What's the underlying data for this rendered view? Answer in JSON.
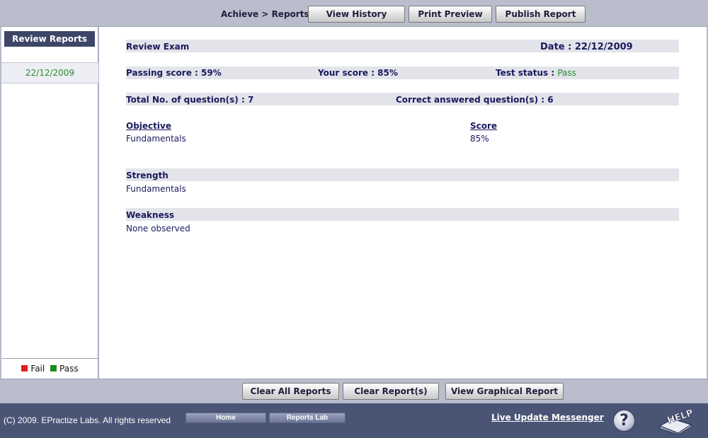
{
  "header": {
    "breadcrumb": "Achieve > Reports",
    "buttons": {
      "view_history": "View History",
      "print_preview": "Print Preview",
      "publish_report": "Publish Report"
    }
  },
  "sidebar": {
    "title": "Review Reports",
    "dates": [
      "22/12/2009"
    ],
    "legend": {
      "fail": "Fail",
      "pass": "Pass"
    }
  },
  "report": {
    "exam_name": "Review Exam",
    "date_label": "Date : 22/12/2009",
    "passing_score": "Passing score : 59%",
    "your_score": "Your score : 85%",
    "test_status_label": "Test status : ",
    "test_status_value": "Pass",
    "total_questions": "Total No. of question(s) : 7",
    "correct_questions": "Correct answered question(s) : 6",
    "objective_header": "Objective ",
    "score_header": "Score",
    "objectives": [
      {
        "name": "Fundamentals",
        "score": "85%"
      }
    ],
    "strength_title": "Strength",
    "strength_value": "Fundamentals",
    "weakness_title": "Weakness",
    "weakness_value": "None observed"
  },
  "bottom_buttons": {
    "clear_all": "Clear All Reports",
    "clear": "Clear Report(s)",
    "graphical": "View Graphical Report"
  },
  "footer": {
    "copyright": "(C) 2009. EPractize Labs. All rights reserved",
    "home": "Home",
    "reports_lab": "Reports Lab",
    "live_update": "Live Update Messenger",
    "question_mark": "?",
    "help_text": "HELP"
  },
  "colors": {
    "fail": "#e02020",
    "pass": "#1e8a1e",
    "status_pass": "#2b8a2b",
    "sidebar_header": "#3d4667",
    "footer_bg": "#4a5576"
  }
}
